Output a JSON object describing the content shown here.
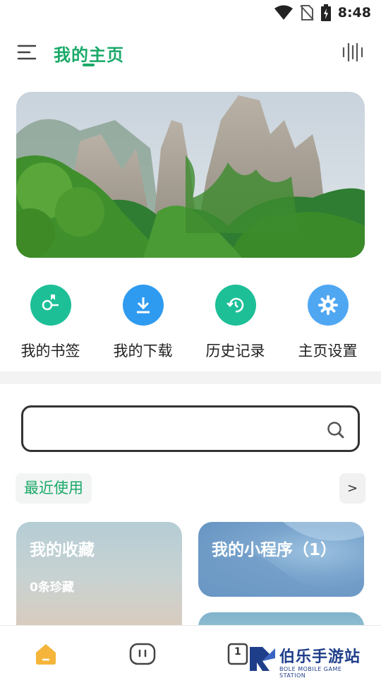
{
  "status_bar": {
    "time": "8:48"
  },
  "header": {
    "title": "我的主页"
  },
  "quick_actions": [
    {
      "label": "我的书签",
      "color": "#1dbf97"
    },
    {
      "label": "我的下载",
      "color": "#2f9bf0"
    },
    {
      "label": "历史记录",
      "color": "#1dbf97"
    },
    {
      "label": "主页设置",
      "color": "#4fa7f2"
    }
  ],
  "search": {
    "placeholder": ""
  },
  "recent": {
    "label": "最近使用",
    "more": ">"
  },
  "cards": {
    "favorites": {
      "title": "我的收藏",
      "subtitle": "0条珍藏"
    },
    "mini_programs": {
      "title": "我的小程序（1）"
    }
  },
  "bottom_nav": {
    "tab_count": "1"
  },
  "watermark": {
    "brand": "伯乐手游站",
    "tagline": "BOLE MOBILE GAME STATION"
  },
  "colors": {
    "accent": "#1aa968"
  }
}
